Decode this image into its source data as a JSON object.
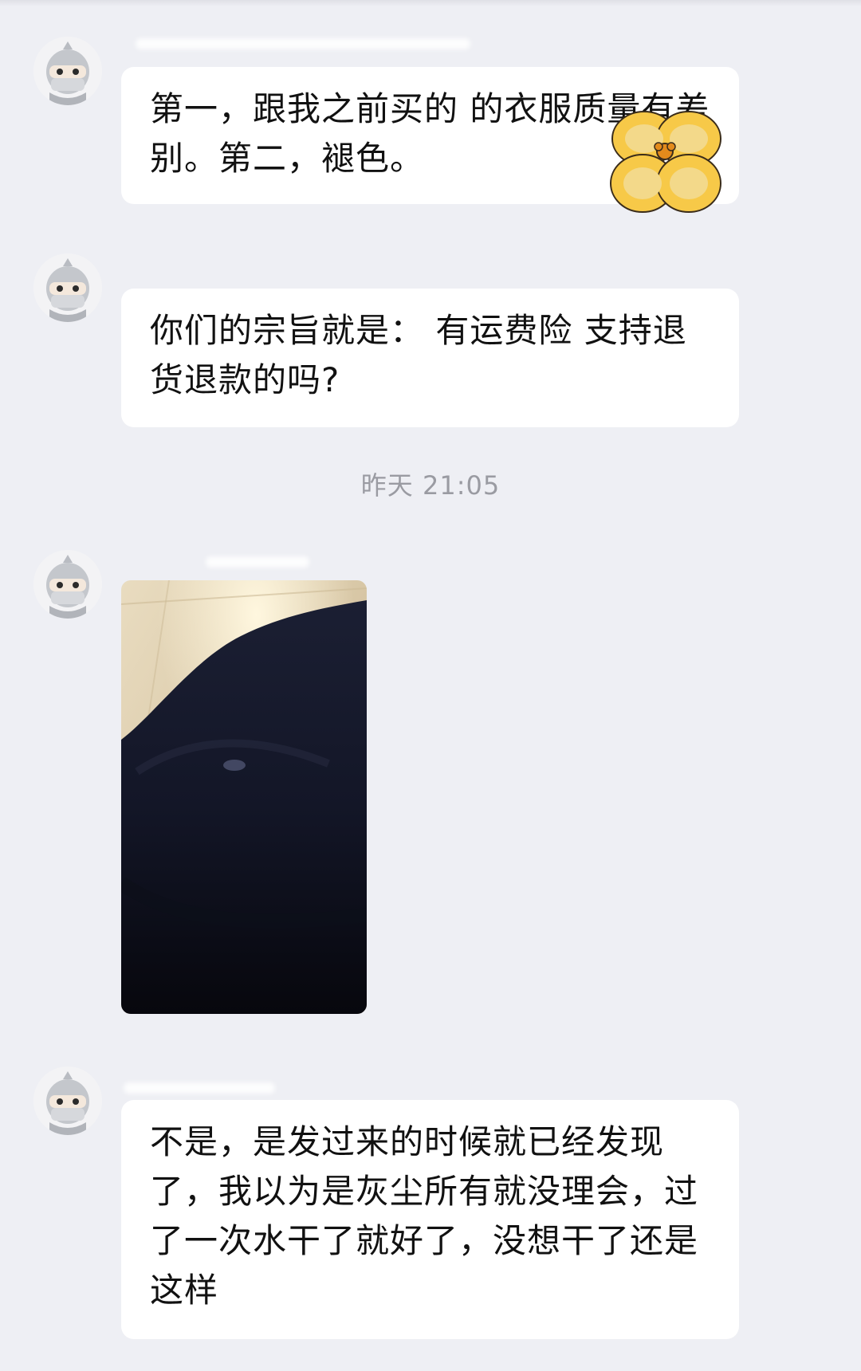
{
  "messages": [
    {
      "type": "text",
      "text": "第一，跟我之前买的          的衣服质量有差别。第二，褪色。"
    },
    {
      "type": "text",
      "text": "你们的宗旨就是： 有运费险 支持退货退款的吗?"
    },
    {
      "type": "timestamp",
      "text": "昨天 21:05"
    },
    {
      "type": "image",
      "description_icon": "photo-of-dark-clothing"
    },
    {
      "type": "text",
      "text": "不是，是发过来的时候就已经发现了，我以为是灰尘所有就没理会，过了一次水干了就好了，没想干了还是这样"
    }
  ],
  "colors": {
    "background": "#eeeff4",
    "bubble": "#ffffff",
    "text": "#111111",
    "timestamp": "#9a9ba2",
    "sticker": "#f7c948"
  }
}
